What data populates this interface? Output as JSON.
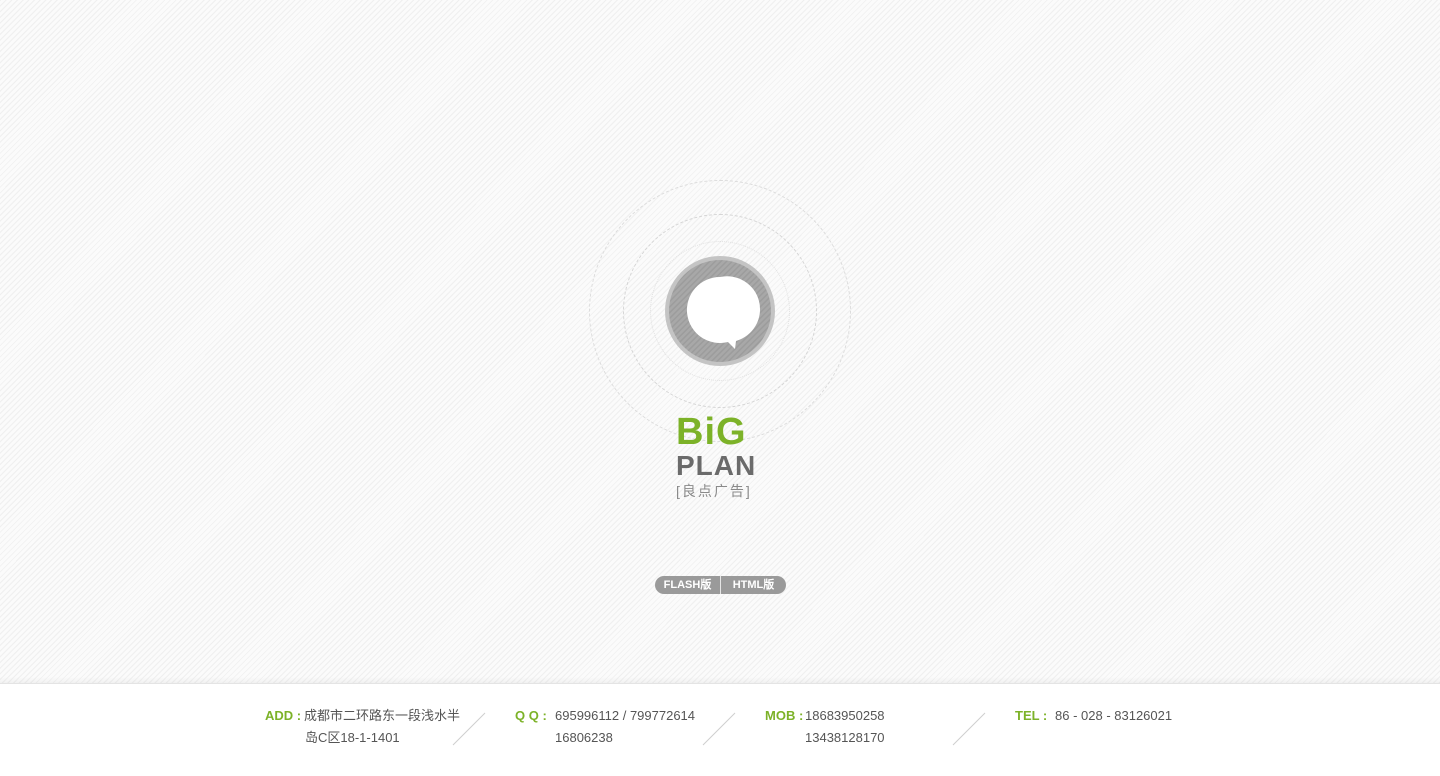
{
  "brand": {
    "big": "BiG",
    "plan": "PLAN",
    "sub": "[良点广告]"
  },
  "versions": {
    "flash_label": "FLASH版",
    "html_label": "HTML版"
  },
  "footer": {
    "add": {
      "label": "ADD :",
      "line1": "成都市二环路东一段浅水半",
      "line2": "岛C区18-1-1401"
    },
    "qq": {
      "label": "Q Q :",
      "line1": "695996112 / 799772614",
      "line2": "16806238"
    },
    "mob": {
      "label": "MOB :",
      "line1": "18683950258",
      "line2": "13438128170"
    },
    "tel": {
      "label": "TEL :",
      "line1": "86 - 028 - 83126021"
    }
  },
  "colors": {
    "accent": "#7cb228",
    "logo_gray": "#a3a3a3",
    "text_gray": "#555555",
    "button_gray": "#9a9a9a"
  },
  "icons": [
    "speech-bubble-logo-icon",
    "divider-slash-icon"
  ]
}
